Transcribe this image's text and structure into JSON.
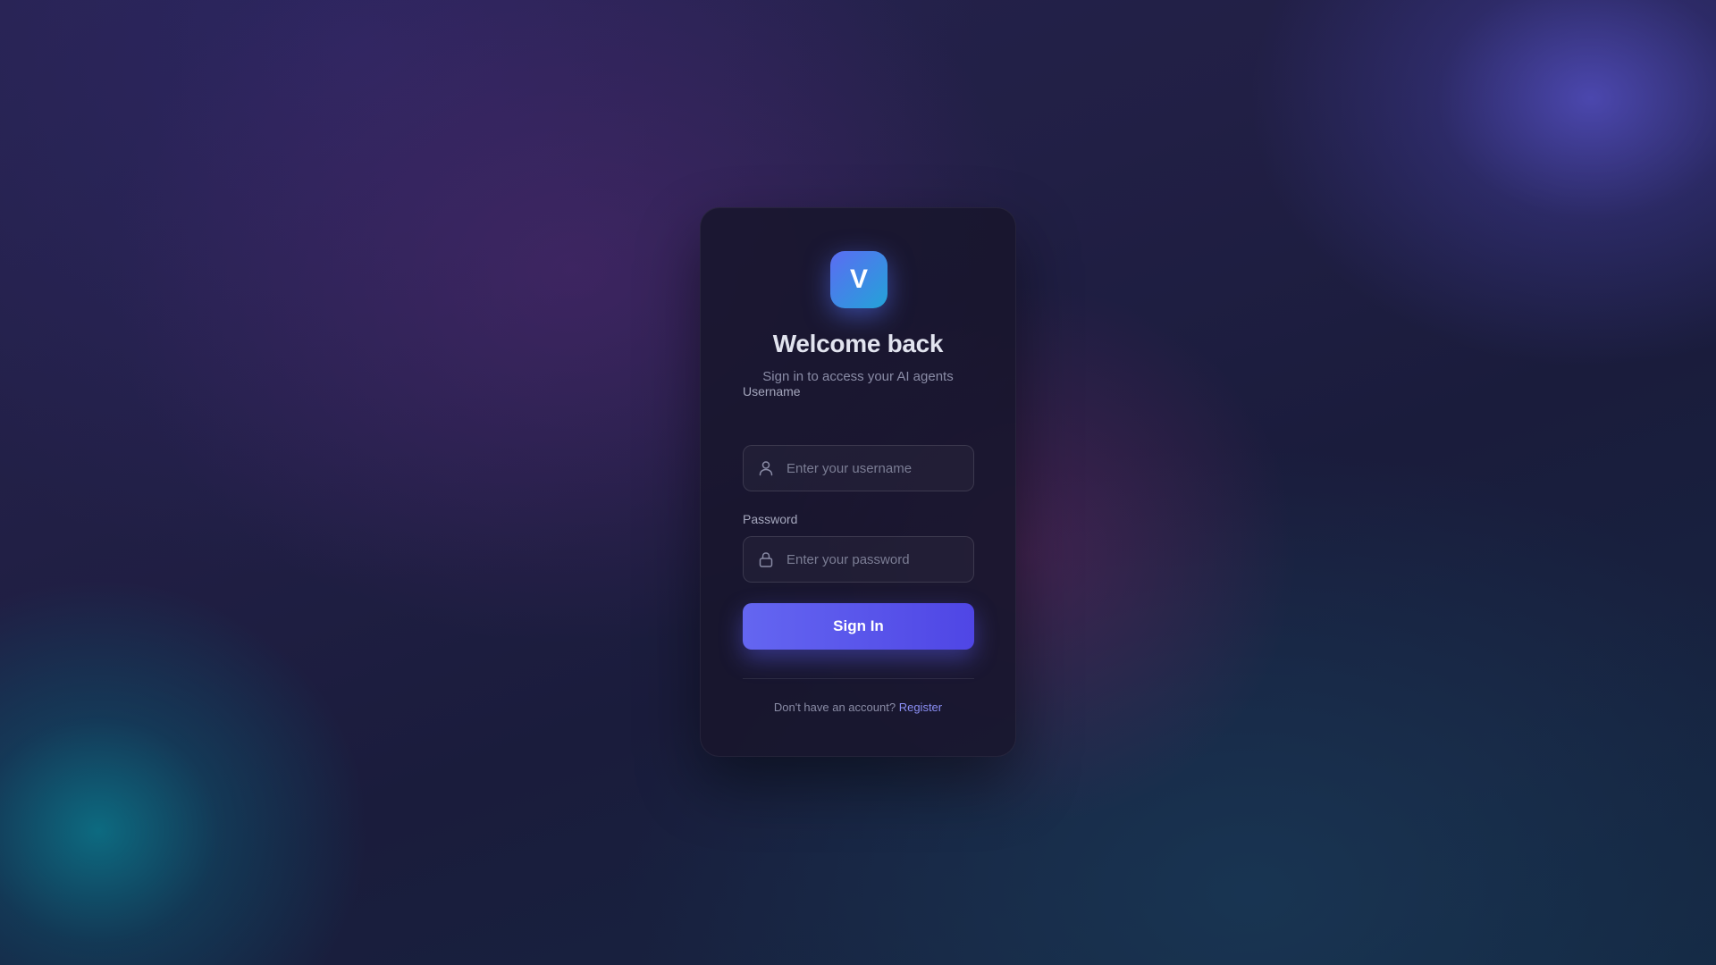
{
  "brand": {
    "logo_letter": "V",
    "accent": "#6366f1",
    "logo_gradient": [
      "#5b6cf3",
      "#23a3d8"
    ]
  },
  "login": {
    "title": "Welcome back",
    "subtitle": "Sign in to access your AI agents",
    "username": {
      "label": "Username",
      "placeholder": "Enter your username",
      "value": "",
      "icon": "user-icon"
    },
    "password": {
      "label": "Password",
      "placeholder": "Enter your password",
      "value": "",
      "icon": "lock-icon"
    },
    "submit_label": "Sign In",
    "footer_text": "Don't have an account?",
    "register_label": "Register"
  }
}
